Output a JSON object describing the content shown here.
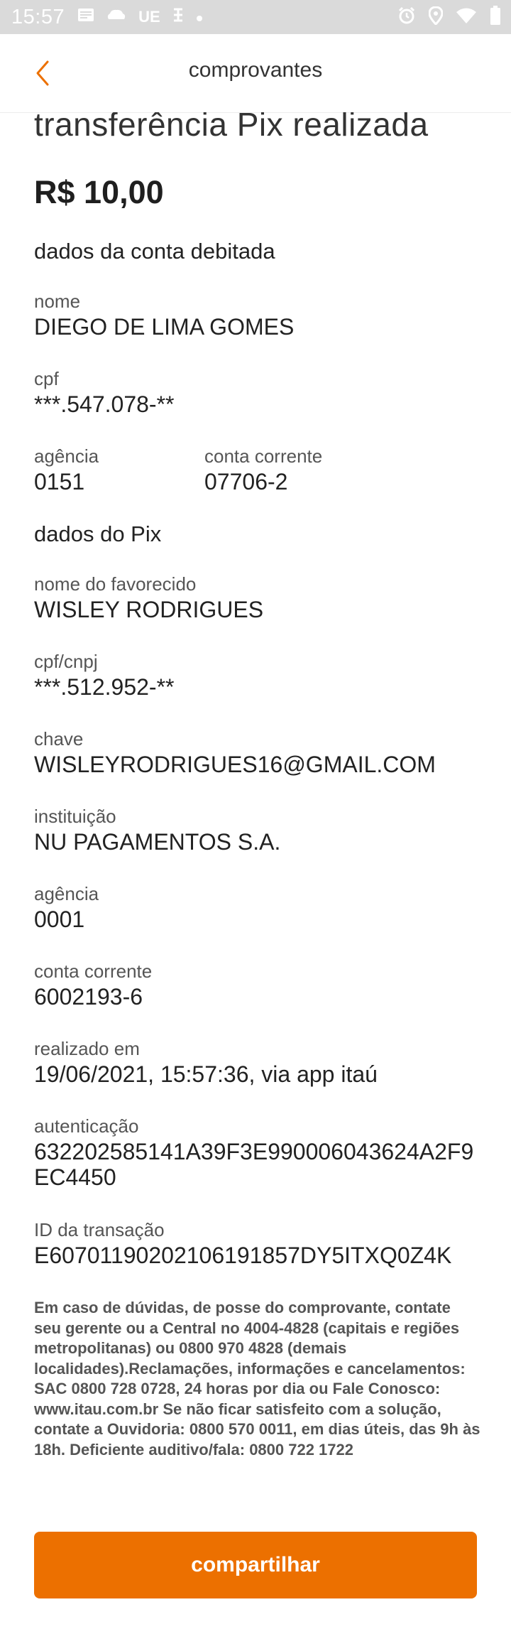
{
  "status_bar": {
    "time": "15:57",
    "carrier_text": "UE",
    "left_icons": [
      "notes-icon",
      "cloud-icon",
      "carrier-text",
      "signal-glyph-icon",
      "dot-icon"
    ],
    "right_icons": [
      "alarm-icon",
      "location-icon",
      "wifi-icon",
      "battery-icon"
    ]
  },
  "app_bar": {
    "title": "comprovantes",
    "back_icon": "chevron-left-icon",
    "accent_color": "#ec7000"
  },
  "receipt": {
    "title": "transferência Pix realizada",
    "amount": "R$ 10,00",
    "debit_section": "dados da conta debitada",
    "nome_label": "nome",
    "nome_value": "DIEGO DE LIMA GOMES",
    "cpf_label": "cpf",
    "cpf_value": "***.547.078-**",
    "agencia_label": "agência",
    "agencia_value": "0151",
    "conta_label": "conta corrente",
    "conta_value": "07706-2",
    "pix_section": "dados do Pix",
    "favorecido_label": "nome do favorecido",
    "favorecido_value": "WISLEY RODRIGUES",
    "cpfcnpj_label": "cpf/cnpj",
    "cpfcnpj_value": "***.512.952-**",
    "chave_label": "chave",
    "chave_value": "WISLEYRODRIGUES16@GMAIL.COM",
    "instituicao_label": "instituição",
    "instituicao_value": "NU PAGAMENTOS S.A.",
    "fav_agencia_label": "agência",
    "fav_agencia_value": "0001",
    "fav_conta_label": "conta corrente",
    "fav_conta_value": "6002193-6",
    "realizado_label": "realizado em",
    "realizado_value": "19/06/2021, 15:57:36, via app itaú",
    "autenticacao_label": "autenticação",
    "autenticacao_value_line1": "632202585141A39F3E990006043624A2F9",
    "autenticacao_value_line2": "EC4450",
    "transacao_label": "ID da transação",
    "transacao_value": "E60701190202106191857DY5ITXQ0Z4K"
  },
  "disclaimer": "Em caso de dúvidas, de posse do comprovante, contate seu gerente ou a Central no 4004-4828 (capitais e regiões metropolitanas) ou 0800 970 4828 (demais localidades).Reclamações, informações e cancelamentos: SAC 0800 728 0728, 24 horas por dia ou Fale Conosco: www.itau.com.br Se não ficar satisfeito com a solução, contate a Ouvidoria: 0800 570 0011, em dias úteis, das 9h às 18h. Deficiente auditivo/fala: 0800 722 1722",
  "share_button": {
    "label": "compartilhar",
    "color": "#ec7000"
  }
}
